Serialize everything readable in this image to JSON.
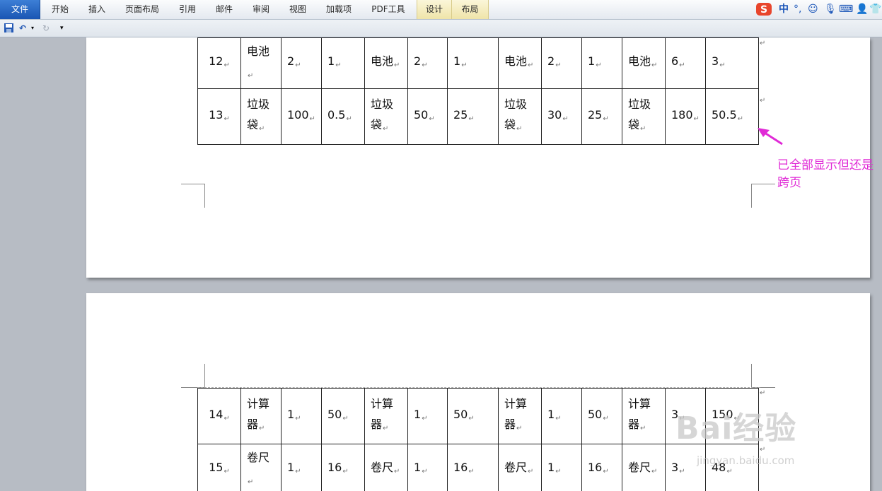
{
  "ribbon": {
    "tabs": [
      "文件",
      "开始",
      "插入",
      "页面布局",
      "引用",
      "邮件",
      "审阅",
      "视图",
      "加载项",
      "PDF工具",
      "设计",
      "布局"
    ],
    "ime_label": "中"
  },
  "colors": {
    "annotation": "#e02ad6",
    "file_tab": "#1a56b3"
  },
  "table_top": {
    "rows": [
      [
        "12",
        "电池",
        "2",
        "1",
        "电池",
        "2",
        "1",
        "电池",
        "2",
        "1",
        "电池",
        "6",
        "3"
      ],
      [
        "13",
        "垃圾袋",
        "100",
        "0.5",
        "垃圾袋",
        "50",
        "25",
        "垃圾袋",
        "30",
        "25",
        "垃圾袋",
        "180",
        "50.5"
      ]
    ]
  },
  "table_bottom": {
    "rows": [
      [
        "14",
        "计算器",
        "1",
        "50",
        "计算器",
        "1",
        "50",
        "计算器",
        "1",
        "50",
        "计算器",
        "3",
        "150"
      ],
      [
        "15",
        "卷尺",
        "1",
        "16",
        "卷尺",
        "1",
        "16",
        "卷尺",
        "1",
        "16",
        "卷尺",
        "3",
        "48"
      ]
    ]
  },
  "annotation": {
    "text": "已全部显示但还是跨页"
  },
  "watermark": {
    "brand": "Bai经验",
    "url": "jingyan.baidu.com"
  }
}
